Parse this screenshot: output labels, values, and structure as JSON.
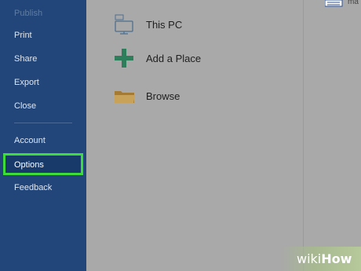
{
  "sidebar": {
    "items": [
      {
        "label": "Publish",
        "id": "publish"
      },
      {
        "label": "Print",
        "id": "print"
      },
      {
        "label": "Share",
        "id": "share"
      },
      {
        "label": "Export",
        "id": "export"
      },
      {
        "label": "Close",
        "id": "close"
      },
      {
        "label": "Account",
        "id": "account"
      },
      {
        "label": "Options",
        "id": "options"
      },
      {
        "label": "Feedback",
        "id": "feedback"
      }
    ]
  },
  "locations": [
    {
      "label": "This PC",
      "icon": "computer-icon"
    },
    {
      "label": "Add a Place",
      "icon": "plus-icon"
    },
    {
      "label": "Browse",
      "icon": "folder-icon"
    }
  ],
  "top_right": {
    "text": "ma"
  },
  "watermark": {
    "prefix": "wiki",
    "suffix": "How"
  },
  "colors": {
    "sidebar_bg": "#22467a",
    "highlight_border": "#3ddc3b",
    "main_bg": "#a9a9a9",
    "plus_green": "#2e7d5b",
    "folder": "#b88c3e"
  }
}
